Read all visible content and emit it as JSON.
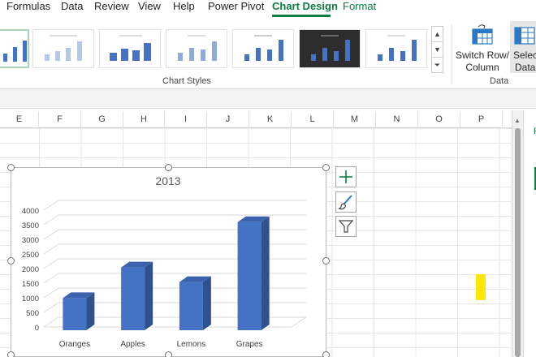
{
  "tabs": [
    "Formulas",
    "Data",
    "Review",
    "View",
    "Help",
    "Power Pivot",
    "Chart Design",
    "Format"
  ],
  "active_tab": "Chart Design",
  "ribbon": {
    "chart_styles_label": "Chart Styles",
    "data_group_label": "Data",
    "switch_row_column_line1": "Switch Row/",
    "switch_row_column_line2": "Column",
    "select_data_line1": "Select",
    "select_data_line2": "Data"
  },
  "columns": [
    "E",
    "F",
    "G",
    "H",
    "I",
    "J",
    "K",
    "L",
    "M",
    "N",
    "O",
    "P"
  ],
  "chart_data": {
    "type": "bar",
    "title": "2013",
    "categories": [
      "Oranges",
      "Apples",
      "Lemons",
      "Grapes"
    ],
    "values": [
      1100,
      2150,
      1650,
      3700
    ],
    "ylim": [
      0,
      4000
    ],
    "yticks": [
      "0",
      "500",
      "1000",
      "1500",
      "2000",
      "2500",
      "3000",
      "3500",
      "4000"
    ],
    "grid": true,
    "bar_color": "#4472c4"
  },
  "colors": {
    "accent_green": "#107c41",
    "yellow_cell": "#ffe600"
  },
  "icons": [
    "switch-row-column-icon",
    "select-data-icon",
    "chart-elements-plus-icon",
    "chart-styles-brush-icon",
    "chart-filters-icon"
  ]
}
